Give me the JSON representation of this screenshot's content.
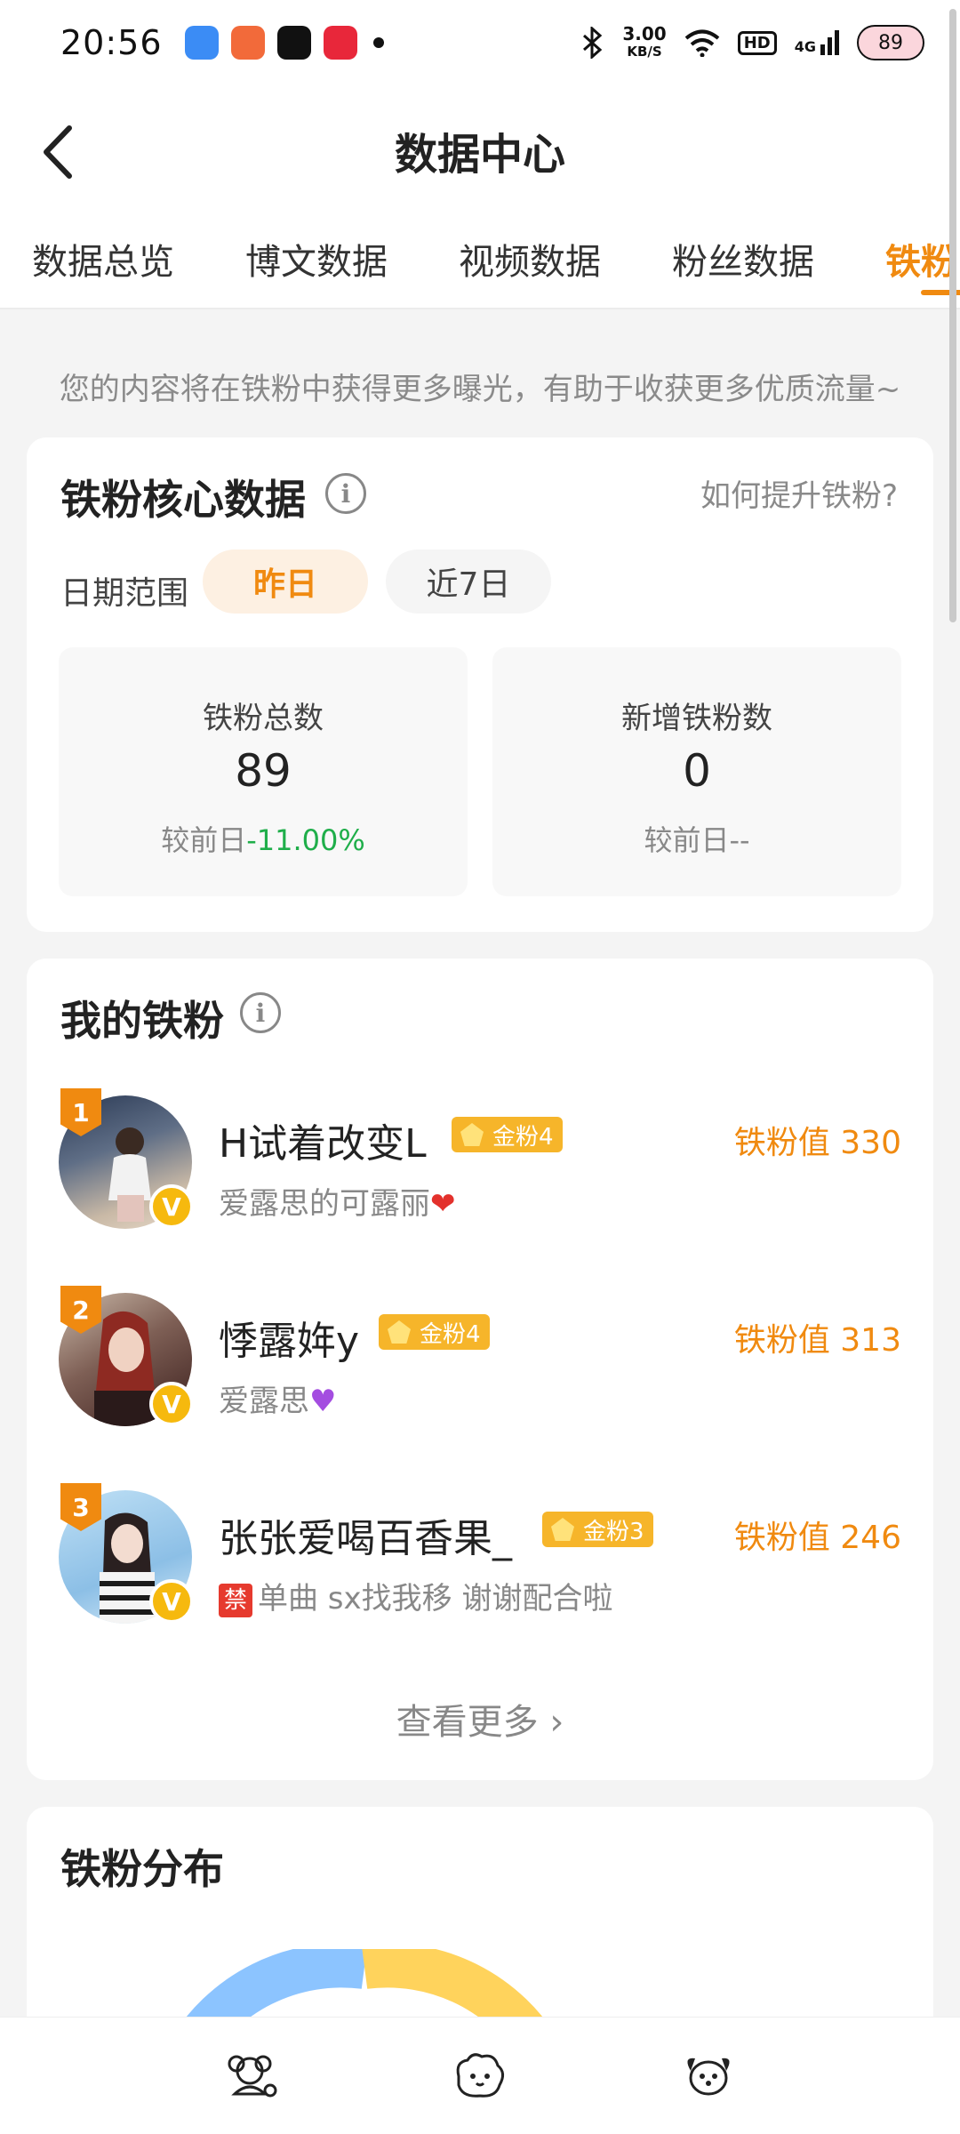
{
  "status_bar": {
    "time": "20:56",
    "net_speed_value": "3.00",
    "net_speed_unit": "KB/S",
    "hd_label": "HD",
    "signal_label": "4G",
    "battery": "89",
    "app_icon_colors": [
      "#3b8cf5",
      "#f26a3a",
      "#111111",
      "#e8273a"
    ]
  },
  "header": {
    "title": "数据中心"
  },
  "tabs": [
    {
      "label": "数据总览",
      "active": false
    },
    {
      "label": "博文数据",
      "active": false
    },
    {
      "label": "视频数据",
      "active": false
    },
    {
      "label": "粉丝数据",
      "active": false
    },
    {
      "label": "铁粉",
      "active": true
    }
  ],
  "hint": "您的内容将在铁粉中获得更多曝光，有助于收获更多优质流量~",
  "core_card": {
    "title": "铁粉核心数据",
    "info_glyph": "i",
    "link": "如何提升铁粉?",
    "range_label": "日期范围",
    "range_options": [
      "昨日",
      "近7日"
    ],
    "selected_range": "昨日",
    "stats": [
      {
        "label": "铁粉总数",
        "value": "89",
        "compare_prefix": "较前日",
        "compare_value": "-11.00%"
      },
      {
        "label": "新增铁粉数",
        "value": "0",
        "compare_prefix": "较前日",
        "compare_value": "--"
      }
    ]
  },
  "fans_card": {
    "title": "我的铁粉",
    "info_glyph": "i",
    "fans": [
      {
        "rank": "1",
        "name": "H试着改变L",
        "level": "金粉4",
        "desc": "爱露思的可露丽",
        "desc_emoji": "❤",
        "score": "铁粉值 330",
        "badge": "V"
      },
      {
        "rank": "2",
        "name": "悸露姩y",
        "level": "金粉4",
        "desc": "爱露思",
        "desc_emoji": "♥",
        "score": "铁粉值 313",
        "badge": "V"
      },
      {
        "rank": "3",
        "name": "张张爱喝百香果_",
        "level": "金粉3",
        "desc": "单曲 sx找我移 谢谢配合啦",
        "ban_label": "禁",
        "score": "铁粉值 246",
        "badge": "V"
      }
    ],
    "more": "查看更多 ›"
  },
  "dist_card": {
    "title": "铁粉分布",
    "chart_colors": [
      "#8cc4ff",
      "#ffd35c"
    ]
  },
  "bottom_nav": [
    "dog-icon",
    "sheep-icon",
    "puppy-icon"
  ]
}
